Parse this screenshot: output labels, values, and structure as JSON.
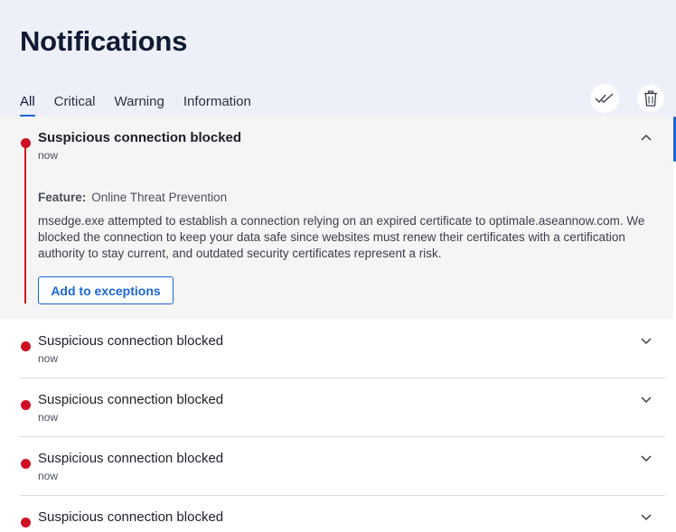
{
  "page": {
    "title": "Notifications"
  },
  "tabs": [
    {
      "label": "All",
      "active": true
    },
    {
      "label": "Critical",
      "active": false
    },
    {
      "label": "Warning",
      "active": false
    },
    {
      "label": "Information",
      "active": false
    }
  ],
  "actions": {
    "mark_all_read_icon": "double-check-icon",
    "delete_all_icon": "trash-icon"
  },
  "expanded": {
    "title": "Suspicious connection blocked",
    "time": "now",
    "feature_label": "Feature:",
    "feature_value": "Online Threat Prevention",
    "description": "msedge.exe attempted to establish a connection relying on an expired certificate to optimale.aseannow.com. We blocked the connection to keep your data safe since websites must renew their certificates with a certification authority to stay current, and outdated security certificates represent a risk.",
    "button_label": "Add to exceptions"
  },
  "notifications": [
    {
      "title": "Suspicious connection blocked",
      "time": "now"
    },
    {
      "title": "Suspicious connection blocked",
      "time": "now"
    },
    {
      "title": "Suspicious connection blocked",
      "time": "now"
    },
    {
      "title": "Suspicious connection blocked",
      "time": ""
    }
  ],
  "colors": {
    "accent": "#1a66d9",
    "critical": "#cf1024",
    "header_bg": "#edf0f8",
    "expanded_bg": "#f5f5f5"
  }
}
